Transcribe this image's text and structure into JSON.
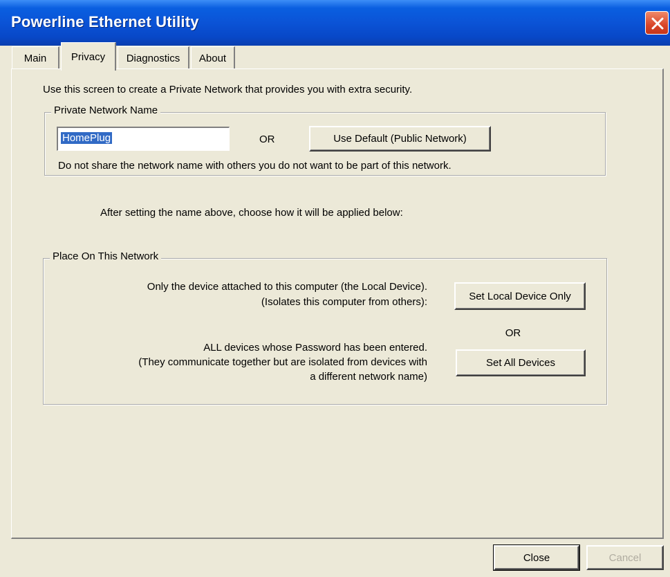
{
  "window": {
    "title": "Powerline Ethernet Utility"
  },
  "tabs": [
    {
      "label": "Main"
    },
    {
      "label": "Privacy"
    },
    {
      "label": "Diagnostics"
    },
    {
      "label": "About"
    }
  ],
  "privacy": {
    "intro": "Use this screen to create a Private Network that provides you with extra security.",
    "private_network": {
      "legend": "Private Network Name",
      "name_value": "HomePlug",
      "or_label": "OR",
      "default_button": "Use Default (Public Network)",
      "warning": "Do not share the network name with others you do not want to be part of this network."
    },
    "after_text": "After setting the name above, choose how it will be applied below:",
    "place": {
      "legend": "Place On This Network",
      "local_line1": "Only the device attached to this computer (the Local Device).",
      "local_line2": "(Isolates this computer from others):",
      "local_button": "Set Local Device Only",
      "or_label": "OR",
      "all_line1": "ALL devices whose Password has been entered.",
      "all_line2": "(They communicate together but are isolated from devices with",
      "all_line3": "a different network name)",
      "all_button": "Set All Devices"
    }
  },
  "footer": {
    "close_label": "Close",
    "cancel_label": "Cancel"
  }
}
